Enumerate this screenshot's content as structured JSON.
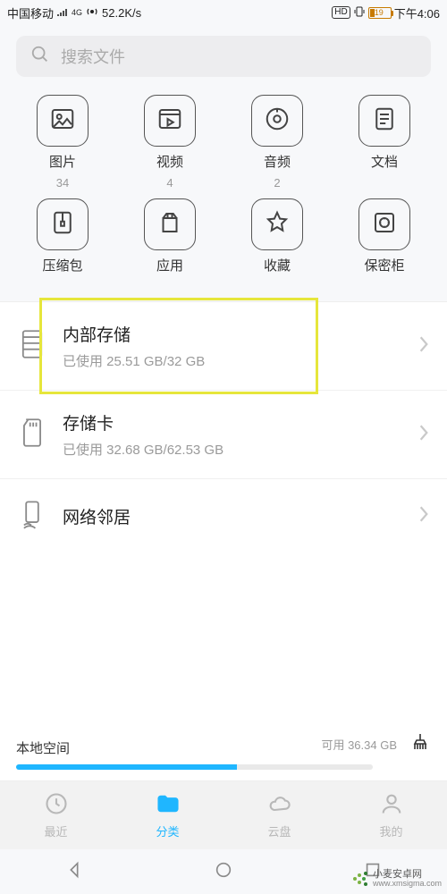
{
  "status": {
    "carrier": "中国移动",
    "net_badge": "4G",
    "speed": "52.2K/s",
    "hd": "HD",
    "battery_pct": "19",
    "time": "下午4:06"
  },
  "search": {
    "placeholder": "搜索文件"
  },
  "categories": [
    {
      "label": "图片",
      "count": "34",
      "icon": "image-icon"
    },
    {
      "label": "视频",
      "count": "4",
      "icon": "video-icon"
    },
    {
      "label": "音频",
      "count": "2",
      "icon": "audio-icon"
    },
    {
      "label": "文档",
      "count": "",
      "icon": "document-icon"
    },
    {
      "label": "压缩包",
      "count": "",
      "icon": "zip-icon"
    },
    {
      "label": "应用",
      "count": "",
      "icon": "app-icon"
    },
    {
      "label": "收藏",
      "count": "",
      "icon": "star-icon"
    },
    {
      "label": "保密柜",
      "count": "",
      "icon": "safe-icon"
    }
  ],
  "storage": [
    {
      "title": "内部存储",
      "sub": "已使用 25.51 GB/32 GB",
      "icon": "internal-storage-icon",
      "highlight": true
    },
    {
      "title": "存储卡",
      "sub": "已使用 32.68 GB/62.53 GB",
      "icon": "sd-card-icon"
    },
    {
      "title": "网络邻居",
      "sub": "",
      "icon": "network-icon"
    }
  ],
  "local_space": {
    "label": "本地空间",
    "available": "可用 36.34 GB",
    "progress_pct": 62
  },
  "tabs": [
    {
      "label": "最近",
      "icon": "clock-icon"
    },
    {
      "label": "分类",
      "icon": "folder-icon",
      "active": true
    },
    {
      "label": "云盘",
      "icon": "cloud-icon"
    },
    {
      "label": "我的",
      "icon": "person-icon"
    }
  ],
  "watermark": {
    "name": "小麦安卓网",
    "url": "www.xmsigma.com"
  }
}
